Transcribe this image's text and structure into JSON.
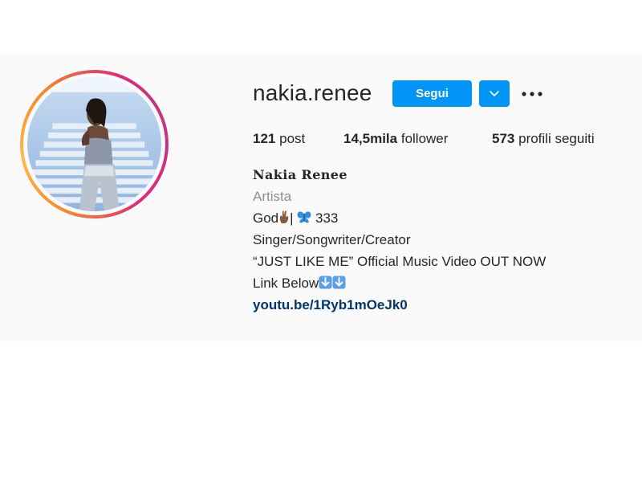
{
  "profile": {
    "username": "nakia.renee",
    "follow_label": "Segui",
    "dropdown_icon": "chevron-down-icon",
    "more_icon": "more-horizontal-icon",
    "stats": {
      "posts_count": "121",
      "posts_label": "post",
      "followers_count": "14,5mila",
      "followers_label": "follower",
      "following_count": "573",
      "following_label": "profili seguiti"
    },
    "bio": {
      "full_name": "Nakia Renee",
      "category": "Artista",
      "line1_prefix": "God",
      "line1_mid": "| ",
      "line1_suffix": " 333",
      "line2": "Singer/Songwriter/Creator",
      "line3": "“JUST LIKE ME” Official Music Video OUT NOW",
      "line4": "Link Below",
      "link": "youtu.be/1Ryb1mOeJk0"
    }
  },
  "colors": {
    "accent": "#0095f6",
    "link": "#00376b",
    "muted": "#8e8e8e",
    "text": "#262626",
    "band": "#fafafa"
  }
}
